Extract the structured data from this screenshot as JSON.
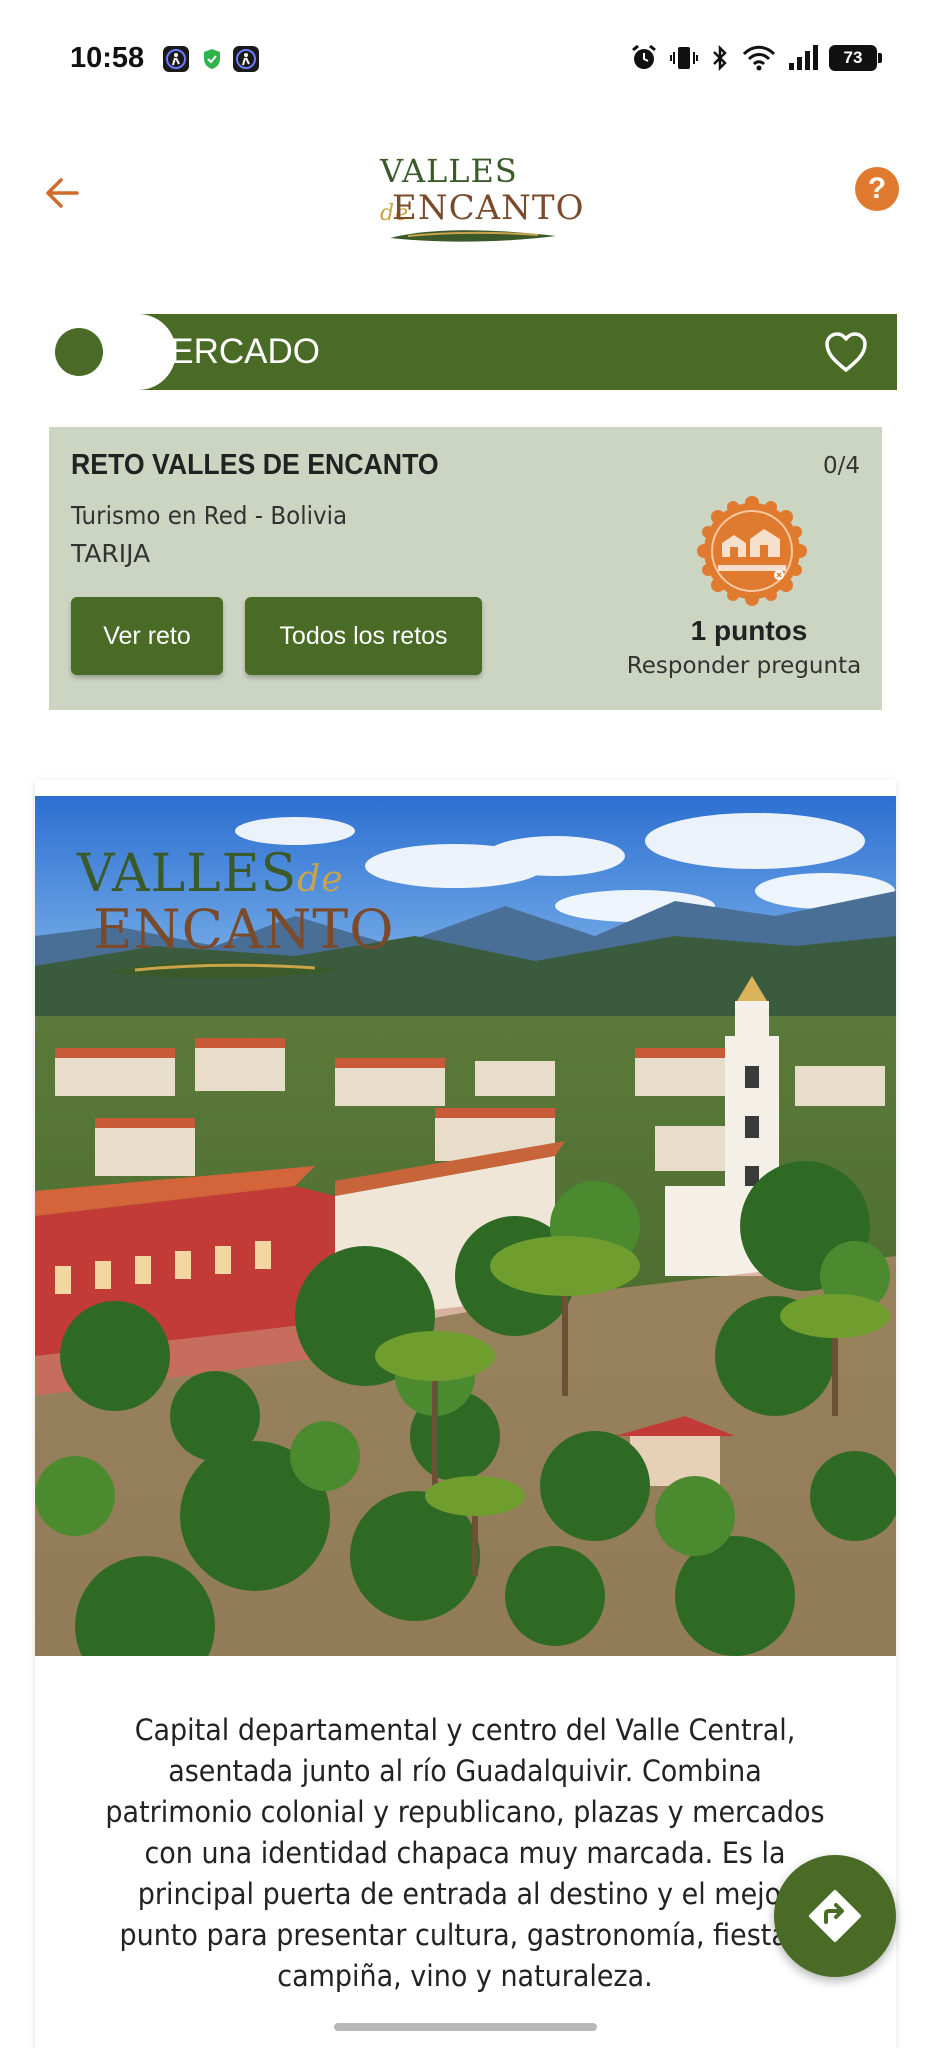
{
  "status_bar": {
    "time": "10:58",
    "battery": "73",
    "icons": [
      "app-icon",
      "shield-icon",
      "app-icon",
      "alarm-icon",
      "vibrate-icon",
      "bluetooth-icon",
      "wifi-icon",
      "signal-icon",
      "battery-icon"
    ]
  },
  "header": {
    "logo_top": "VALLES",
    "logo_de": "de",
    "logo_bottom": "ENCANTO",
    "help_label": "?"
  },
  "section": {
    "title": "CERCADO"
  },
  "challenge": {
    "title": "RETO VALLES DE ENCANTO",
    "progress": "0/4",
    "organization": "Turismo en Red - Bolivia",
    "region": "TARIJA",
    "view_button": "Ver reto",
    "all_button": "Todos los retos",
    "points": "1 puntos",
    "points_desc": "Responder pregunta"
  },
  "hero": {
    "logo_top": "VALLES",
    "logo_de": "de",
    "logo_bottom": "ENCANTO"
  },
  "description": "Capital departamental y centro del Valle Central, asentada junto al río Guadalquivir. Combina patrimonio colonial y republicano, plazas y mercados con una identidad chapaca muy marcada. Es la principal puerta de entrada al destino y el mejor punto para presentar cultura, gastronomía, fiestas, campiña, vino y naturaleza.",
  "colors": {
    "primary_green": "#4a6b26",
    "accent_orange": "#e07a2e",
    "card_bg": "#ccd5c2"
  }
}
